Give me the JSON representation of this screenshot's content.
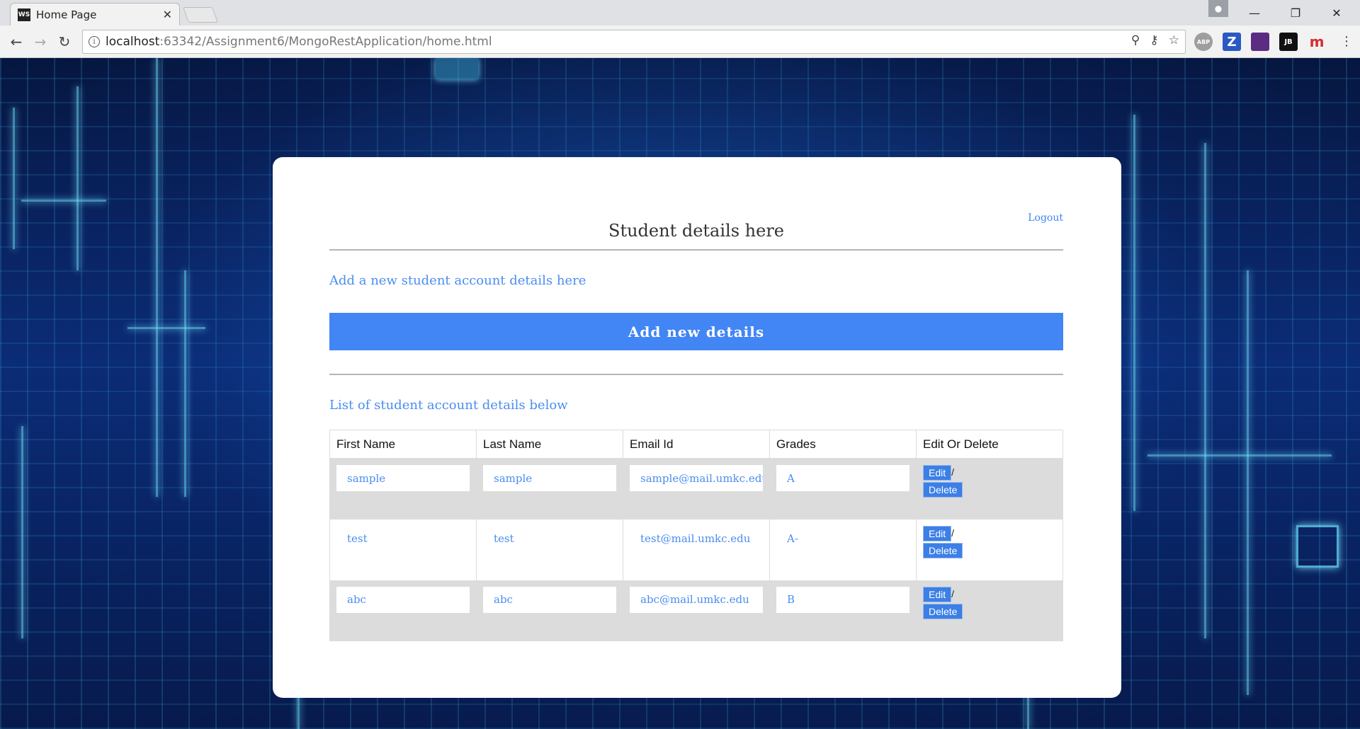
{
  "browser": {
    "tab_title": "Home Page",
    "tab_favicon": "WS",
    "url_host": "localhost",
    "url_rest": ":63342/Assignment6/MongoRestApplication/home.html",
    "extensions": [
      {
        "name": "adblock-plus-icon",
        "label": "ABP",
        "color": "#9e9e9e"
      },
      {
        "name": "zotero-icon",
        "label": "Z",
        "color": "#2b59c3"
      },
      {
        "name": "extension-icon",
        "label": "",
        "color": "#5a2d82"
      },
      {
        "name": "jetbrains-icon",
        "label": "JB",
        "color": "#111111"
      },
      {
        "name": "mendeley-icon",
        "label": "m",
        "color": "#ffffff"
      }
    ]
  },
  "page": {
    "title": "Student details here",
    "logout": "Logout",
    "add_heading": "Add a new student account details here",
    "add_button": "Add new details",
    "list_heading": "List of student account details below",
    "accent_color": "#4285f4"
  },
  "table": {
    "headers": [
      "First Name",
      "Last Name",
      "Email Id",
      "Grades",
      "Edit Or Delete"
    ],
    "rows": [
      {
        "first": "sample",
        "last": "sample",
        "email": "sample@mail.umkc.edu",
        "grade": "A"
      },
      {
        "first": "test",
        "last": "test",
        "email": "test@mail.umkc.edu",
        "grade": "A-"
      },
      {
        "first": "abc",
        "last": "abc",
        "email": "abc@mail.umkc.edu",
        "grade": "B"
      }
    ],
    "edit_label": "Edit",
    "delete_label": "Delete",
    "separator": "/"
  }
}
